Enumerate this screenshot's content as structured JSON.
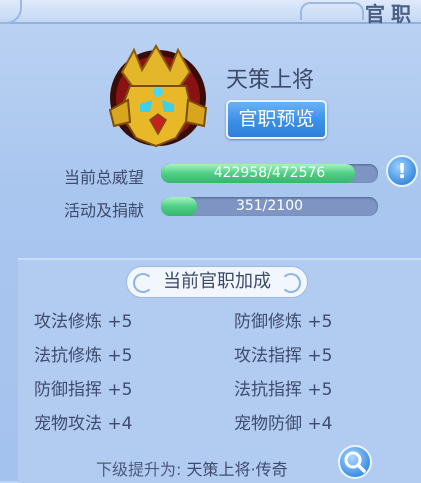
{
  "window": {
    "title": "官职"
  },
  "rank": {
    "name": "天策上将",
    "preview_button": "官职预览"
  },
  "stats": [
    {
      "label": "当前总威望",
      "value_text": "422958/472576",
      "current": 422958,
      "max": 472576
    },
    {
      "label": "活动及捐献",
      "value_text": "351/2100",
      "current": 351,
      "max": 2100
    }
  ],
  "info_button": {
    "icon": "exclamation-icon",
    "glyph": "!"
  },
  "bonus_panel": {
    "title": "当前官职加成",
    "items": [
      {
        "name": "攻法修炼",
        "value": "+5"
      },
      {
        "name": "防御修炼",
        "value": "+5"
      },
      {
        "name": "法抗修炼",
        "value": "+5"
      },
      {
        "name": "攻法指挥",
        "value": "+5"
      },
      {
        "name": "防御指挥",
        "value": "+5"
      },
      {
        "name": "法抗指挥",
        "value": "+5"
      },
      {
        "name": "宠物攻法",
        "value": "+4"
      },
      {
        "name": "宠物防御",
        "value": "+4"
      }
    ]
  },
  "footer": {
    "label": "下级提升为:",
    "next_rank": "天策上将·传奇",
    "search_icon": "magnifier-icon"
  },
  "colors": {
    "accent": "#3b8fe6",
    "bar_fill": "#4fcf84",
    "bar_track": "#7e95c4",
    "text": "#3d4c6e"
  }
}
